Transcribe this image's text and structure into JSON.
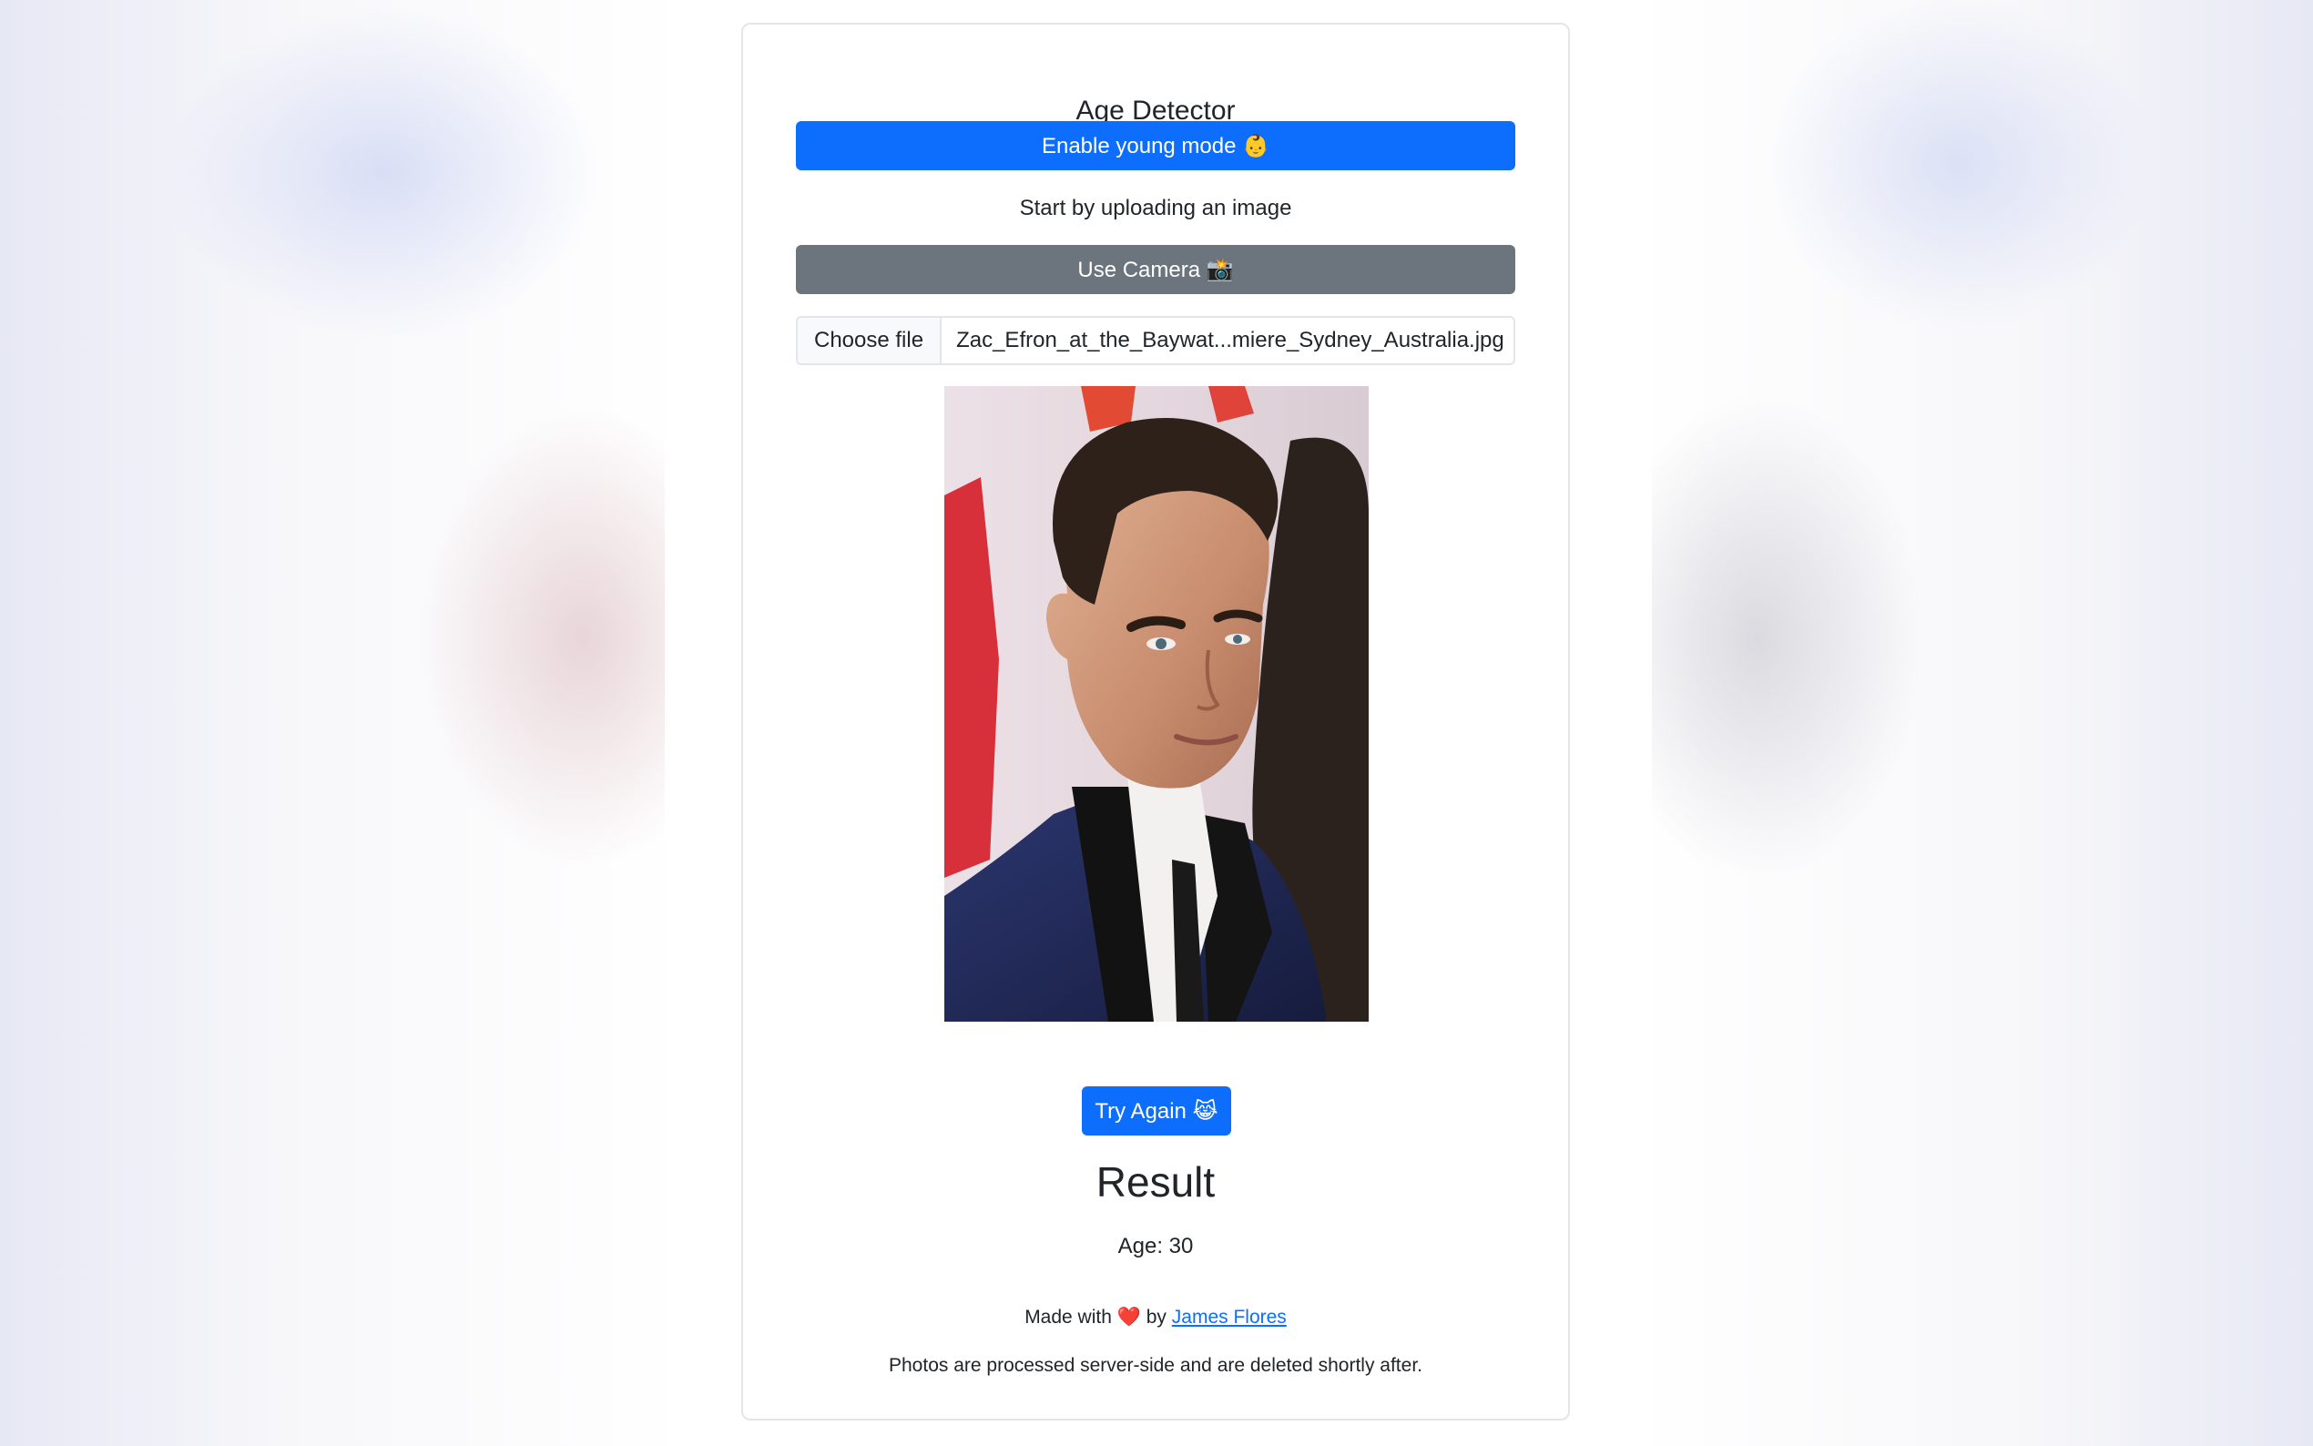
{
  "app": {
    "title": "Age Detector"
  },
  "buttons": {
    "young_mode": "Enable young mode 👶",
    "use_camera": "Use Camera 📸",
    "try_again": "Try Again 😹"
  },
  "upload": {
    "prompt": "Start by uploading an image",
    "choose_file_label": "Choose file",
    "file_name": "Zac_Efron_at_the_Baywat...miere_Sydney_Australia.jpg"
  },
  "photo": {
    "alt": "Zac_Efron_at_the_Baywat...miere_Sydney_Australia.jpg"
  },
  "result": {
    "heading": "Result",
    "age_text": "Age: 30"
  },
  "footer": {
    "made_with": "Made with",
    "heart": "❤️",
    "by": "by",
    "author": "James Flores",
    "privacy": "Photos are processed server-side and are deleted shortly after."
  },
  "colors": {
    "primary": "#0d6efd",
    "secondary": "#6c757d",
    "heart": "#e0241b"
  }
}
